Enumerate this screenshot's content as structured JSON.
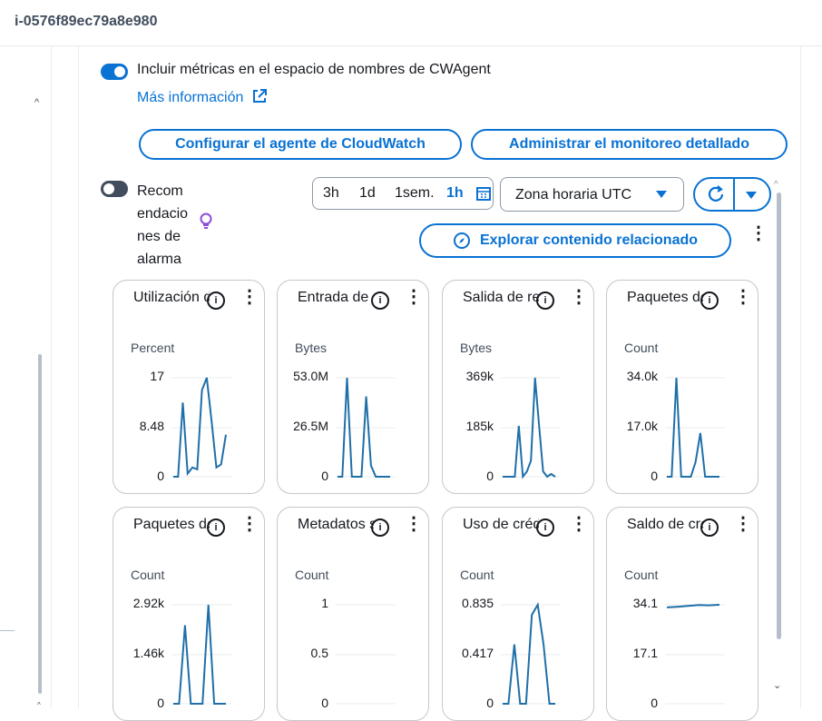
{
  "header": {
    "instance_id": "i-0576f89ec79a8e980"
  },
  "cwagent": {
    "toggle_label": "Incluir métricas en el espacio de nombres de CWAgent",
    "more_info": "Más información"
  },
  "actions": {
    "configure_agent": "Configurar el agente de CloudWatch",
    "manage_monitoring": "Administrar el monitoreo detallado",
    "explore_related": "Explorar contenido relacionado"
  },
  "alarm_recs": {
    "label_lines": [
      "Recom",
      "endacio",
      "nes de",
      "alarma"
    ]
  },
  "time_range": {
    "options": [
      "3h",
      "1d",
      "1sem.",
      "1h"
    ],
    "selected": "1h"
  },
  "timezone": {
    "value": "Zona horaria UTC"
  },
  "widgets": [
    {
      "title": "Utilización d",
      "unit": "Percent",
      "ticks": [
        "17",
        "8.48",
        "0"
      ],
      "series": [
        0,
        0,
        12,
        0.5,
        1.5,
        1.2,
        14,
        16,
        9,
        1.5,
        2,
        6.8
      ]
    },
    {
      "title": "Entrada de",
      "unit": "Bytes",
      "ticks": [
        "53.0M",
        "26.5M",
        "0"
      ],
      "series": [
        0,
        0,
        53,
        0,
        0,
        0,
        43,
        6,
        0,
        0,
        0,
        0
      ]
    },
    {
      "title": "Salida de re",
      "unit": "Bytes",
      "ticks": [
        "369k",
        "185k",
        "0"
      ],
      "series": [
        0,
        0,
        0,
        0,
        190,
        0,
        20,
        60,
        369,
        190,
        20,
        0,
        10,
        0
      ]
    },
    {
      "title": "Paquetes de",
      "unit": "Count",
      "ticks": [
        "34.0k",
        "17.0k",
        "0"
      ],
      "series": [
        0,
        0,
        34,
        0,
        0,
        0,
        5,
        15,
        0,
        0,
        0,
        0
      ]
    },
    {
      "title": "Paquetes de",
      "unit": "Count",
      "ticks": [
        "2.92k",
        "1.46k",
        "0"
      ],
      "series": [
        0,
        0,
        2.3,
        0,
        0,
        0,
        2.9,
        0,
        0,
        0
      ]
    },
    {
      "title": "Metadatos s",
      "unit": "Count",
      "ticks": [
        "1",
        "0.5",
        "0"
      ],
      "series": []
    },
    {
      "title": "Uso de créd",
      "unit": "Count",
      "ticks": [
        "0.835",
        "0.417",
        "0"
      ],
      "series": [
        0,
        0,
        0.5,
        0,
        0,
        0.75,
        0.835,
        0.5,
        0,
        0
      ]
    },
    {
      "title": "Saldo de cré",
      "unit": "Count",
      "ticks": [
        "34.1",
        "17.1",
        "0"
      ],
      "series": [
        33.2,
        33.4,
        33.7,
        34.0,
        33.9,
        34.1
      ]
    }
  ]
}
